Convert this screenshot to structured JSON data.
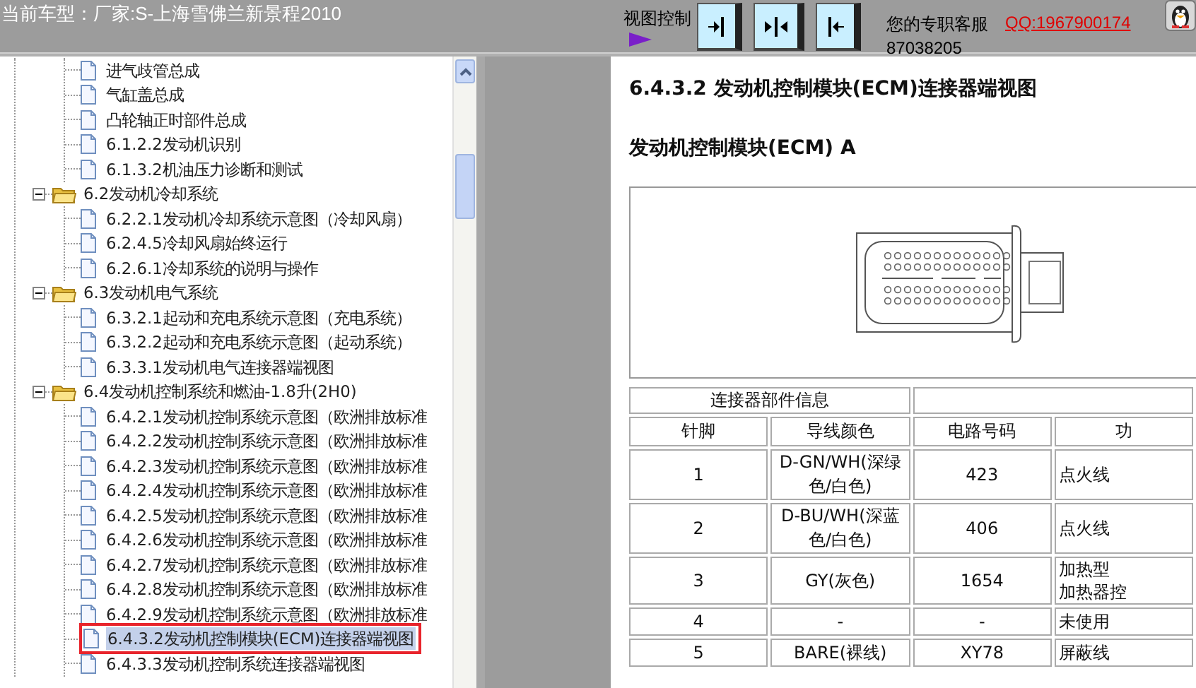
{
  "header": {
    "vehicle": "当前车型：厂家:S-上海雪佛兰新景程2010",
    "view_control_label": "视图控制",
    "view_buttons": [
      {
        "kind": "show-right"
      },
      {
        "kind": "show-both"
      },
      {
        "kind": "show-left"
      }
    ],
    "contact_label": "您的专职客服",
    "qq_link": "QQ:1967900174",
    "phone": "87038205"
  },
  "tree": [
    {
      "kind": "group",
      "children": [
        {
          "kind": "page",
          "label": "进气歧管总成",
          "selected": false
        },
        {
          "kind": "page",
          "label": "气缸盖总成",
          "selected": false
        },
        {
          "kind": "page",
          "label": "凸轮轴正时部件总成",
          "selected": false
        },
        {
          "kind": "page",
          "label": "6.1.2.2发动机识别",
          "selected": false
        },
        {
          "kind": "page",
          "label": "6.1.3.2机油压力诊断和测试",
          "selected": false
        }
      ]
    },
    {
      "kind": "folder",
      "label": "6.2发动机冷却系统",
      "expanded": true,
      "selected": false,
      "children": [
        {
          "kind": "page",
          "label": "6.2.2.1发动机冷却系统示意图（冷却风扇）",
          "selected": false
        },
        {
          "kind": "page",
          "label": "6.2.4.5冷却风扇始终运行",
          "selected": false
        },
        {
          "kind": "page",
          "label": "6.2.6.1冷却系统的说明与操作",
          "selected": false
        }
      ]
    },
    {
      "kind": "folder",
      "label": "6.3发动机电气系统",
      "expanded": true,
      "selected": false,
      "children": [
        {
          "kind": "page",
          "label": "6.3.2.1起动和充电系统示意图（充电系统）",
          "selected": false
        },
        {
          "kind": "page",
          "label": "6.3.2.2起动和充电系统示意图（起动系统）",
          "selected": false
        },
        {
          "kind": "page",
          "label": "6.3.3.1发动机电气连接器端视图",
          "selected": false
        }
      ]
    },
    {
      "kind": "folder",
      "label": "6.4发动机控制系统和燃油-1.8升(2H0)",
      "expanded": true,
      "selected": false,
      "children": [
        {
          "kind": "page",
          "label": "6.4.2.1发动机控制系统示意图（欧洲排放标准",
          "selected": false
        },
        {
          "kind": "page",
          "label": "6.4.2.2发动机控制系统示意图（欧洲排放标准",
          "selected": false
        },
        {
          "kind": "page",
          "label": "6.4.2.3发动机控制系统示意图（欧洲排放标准",
          "selected": false
        },
        {
          "kind": "page",
          "label": "6.4.2.4发动机控制系统示意图（欧洲排放标准",
          "selected": false
        },
        {
          "kind": "page",
          "label": "6.4.2.5发动机控制系统示意图（欧洲排放标准",
          "selected": false
        },
        {
          "kind": "page",
          "label": "6.4.2.6发动机控制系统示意图（欧洲排放标准",
          "selected": false
        },
        {
          "kind": "page",
          "label": "6.4.2.7发动机控制系统示意图（欧洲排放标准",
          "selected": false
        },
        {
          "kind": "page",
          "label": "6.4.2.8发动机控制系统示意图（欧洲排放标准",
          "selected": false
        },
        {
          "kind": "page",
          "label": "6.4.2.9发动机控制系统示意图（欧洲排放标准",
          "selected": false
        },
        {
          "kind": "page",
          "label": "6.4.3.2发动机控制模块(ECM)连接器端视图",
          "selected": true
        },
        {
          "kind": "page",
          "label": "6.4.3.3发动机控制系统连接器端视图",
          "selected": false
        }
      ]
    }
  ],
  "document": {
    "title": "6.4.3.2 发动机控制模块(ECM)连接器端视图",
    "subtitle": "发动机控制模块(ECM) A",
    "table": {
      "group_header": "连接器部件信息",
      "columns": [
        "针脚",
        "导线颜色",
        "电路号码",
        "功"
      ],
      "rows": [
        [
          "1",
          "D-GN/WH(深绿色/白色)",
          "423",
          "点火线"
        ],
        [
          "2",
          "D-BU/WH(深蓝色/白色)",
          "406",
          "点火线"
        ],
        [
          "3",
          "GY(灰色)",
          "1654",
          [
            "加热型",
            "加热器控"
          ]
        ],
        [
          "4",
          "-",
          "-",
          "未使用"
        ],
        [
          "5",
          "BARE(裸线)",
          "XY78",
          "屏蔽线"
        ]
      ]
    }
  }
}
